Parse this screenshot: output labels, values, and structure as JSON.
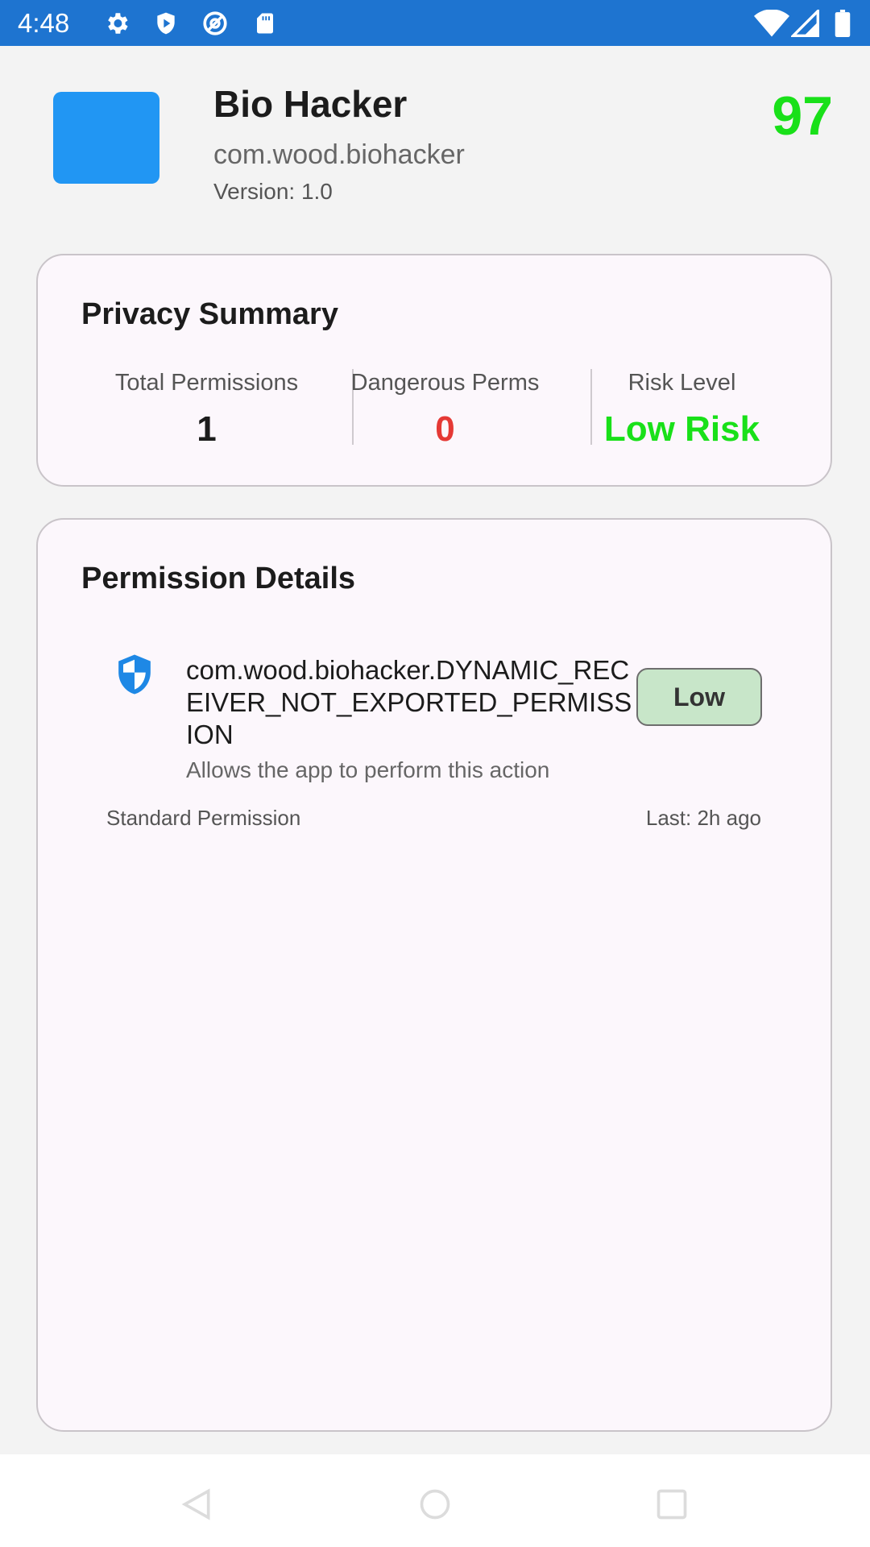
{
  "status_bar": {
    "time": "4:48",
    "left_icons": [
      "settings-icon",
      "shield-play-icon",
      "at-sign-icon",
      "sd-card-icon"
    ],
    "right_icons": [
      "wifi-icon",
      "signal-icon",
      "battery-icon"
    ],
    "color": "#1e74d0"
  },
  "app": {
    "name": "Bio Hacker",
    "package": "com.wood.biohacker",
    "version": "Version: 1.0",
    "score": "97",
    "icon_color": "#2196f3",
    "score_color": "#19e019"
  },
  "privacy_summary": {
    "title": "Privacy Summary",
    "stats": [
      {
        "label": "Total Permissions",
        "value": "1",
        "color": "#1c1c1c"
      },
      {
        "label": "Dangerous Perms",
        "value": "0",
        "color": "#e53935"
      },
      {
        "label": "Risk Level",
        "value": "Low Risk",
        "color": "#19e019"
      }
    ]
  },
  "permission_details": {
    "title": "Permission Details",
    "items": [
      {
        "icon": "shield-icon",
        "name": "com.wood.biohacker.DYNAMIC_RECEIVER_NOT_EXPORTED_PERMISSION",
        "badge": "Low",
        "badge_color": "#c8e6c9",
        "description": "Allows the app to perform this action",
        "type": "Standard Permission",
        "last": "Last: 2h ago"
      }
    ]
  },
  "nav_bar": {
    "buttons": [
      "back-icon",
      "home-icon",
      "recents-icon"
    ]
  }
}
